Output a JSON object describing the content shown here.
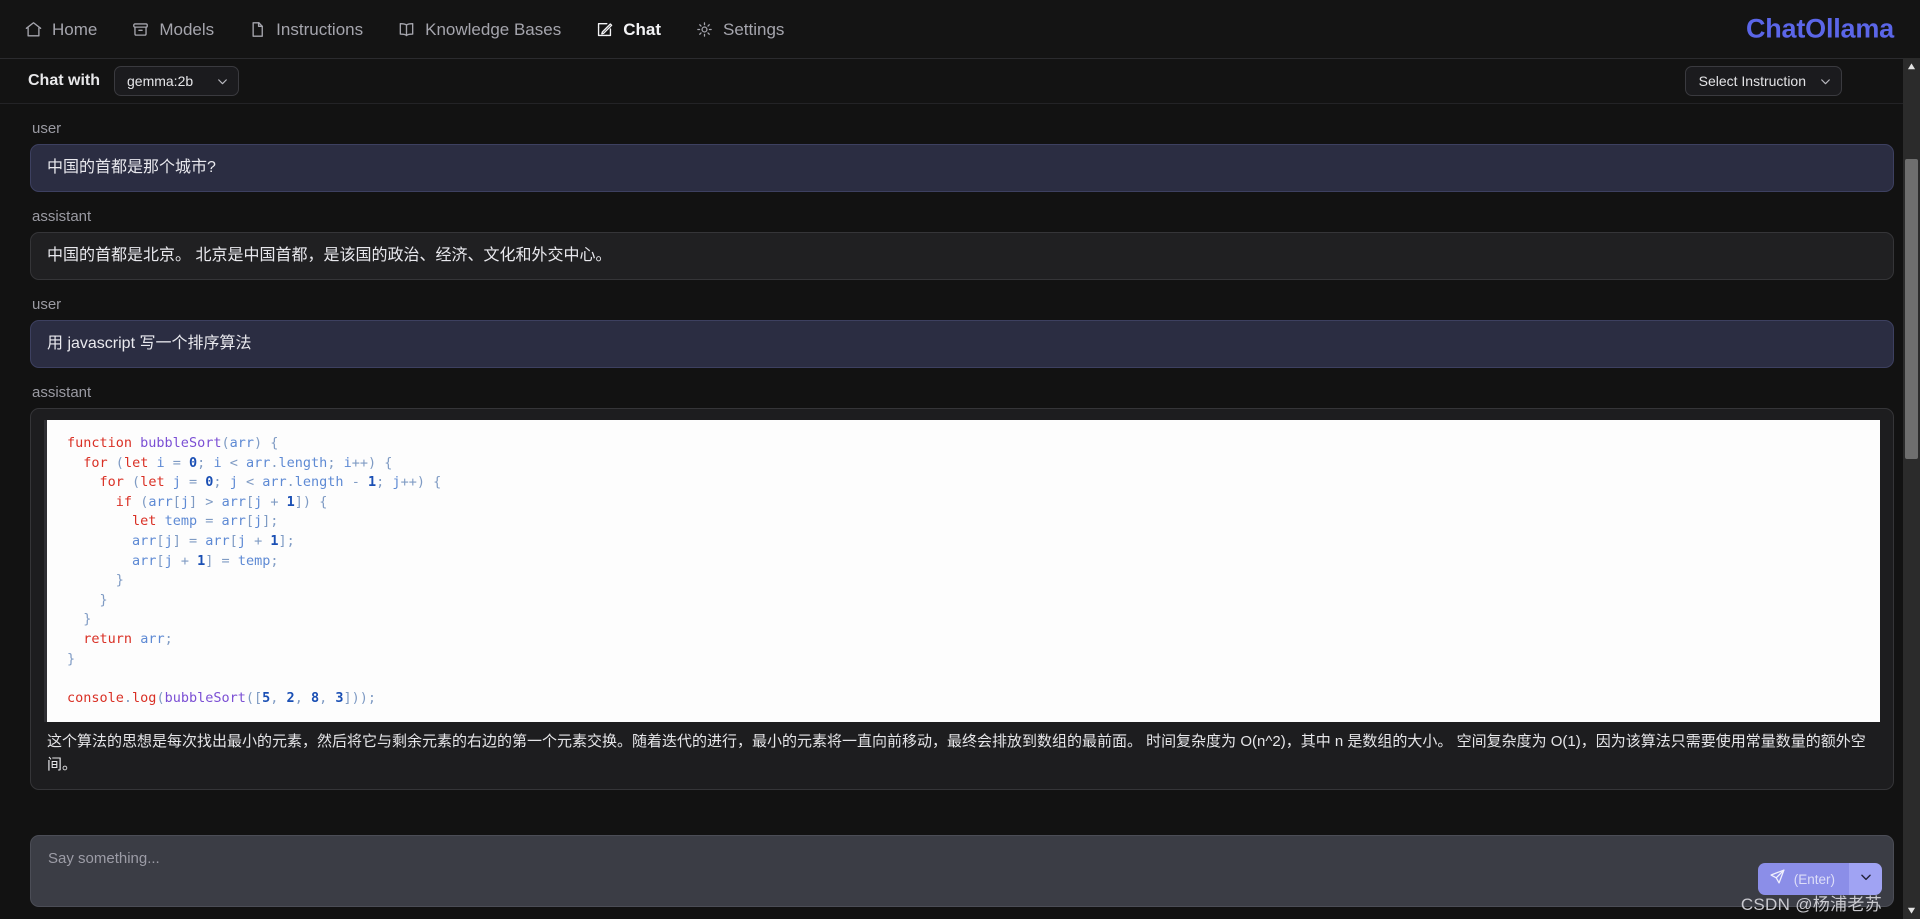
{
  "nav": {
    "items": [
      {
        "label": "Home",
        "icon": "home-icon",
        "active": false
      },
      {
        "label": "Models",
        "icon": "box-icon",
        "active": false
      },
      {
        "label": "Instructions",
        "icon": "document-icon",
        "active": false
      },
      {
        "label": "Knowledge Bases",
        "icon": "book-icon",
        "active": false
      },
      {
        "label": "Chat",
        "icon": "pencil-square-icon",
        "active": true
      },
      {
        "label": "Settings",
        "icon": "gear-icon",
        "active": false
      }
    ],
    "brand": "ChatOllama",
    "brand_color": "#5b66e8"
  },
  "chat_header": {
    "chat_with_label": "Chat with",
    "model_value": "gemma:2b",
    "instruction_value": "Select Instruction"
  },
  "conversation": [
    {
      "role": "user",
      "text": "中国的首都是那个城市?"
    },
    {
      "role": "assistant",
      "text": "中国的首都是北京。 北京是中国首都，是该国的政治、经济、文化和外交中心。"
    },
    {
      "role": "user",
      "text": "用 javascript 写一个排序算法"
    },
    {
      "role": "assistant",
      "code_language": "javascript",
      "code_lines": [
        "function bubbleSort(arr) {",
        "  for (let i = 0; i < arr.length; i++) {",
        "    for (let j = 0; j < arr.length - 1; j++) {",
        "      if (arr[j] > arr[j + 1]) {",
        "        let temp = arr[j];",
        "        arr[j] = arr[j + 1];",
        "        arr[j + 1] = temp;",
        "      }",
        "    }",
        "  }",
        "  return arr;",
        "}",
        "",
        "console.log(bubbleSort([5, 2, 8, 3]));"
      ],
      "explanation": "这个算法的思想是每次找出最小的元素，然后将它与剩余元素的右边的第一个元素交换。随着迭代的进行，最小的元素将一直向前移动，最终会排放到数组的最前面。 时间复杂度为 O(n^2)，其中 n 是数组的大小。 空间复杂度为 O(1)，因为该算法只需要使用常量数量的额外空间。"
    }
  ],
  "composer": {
    "placeholder": "Say something...",
    "send_label": "(Enter)",
    "send_icon": "paper-plane-icon",
    "send_color": "#8b8ee8",
    "send_split_color": "#a0a3f3"
  },
  "watermark": "CSDN @杨浦老苏",
  "scrollbar": {
    "up_arrow": "▲",
    "down_arrow": "▼"
  }
}
